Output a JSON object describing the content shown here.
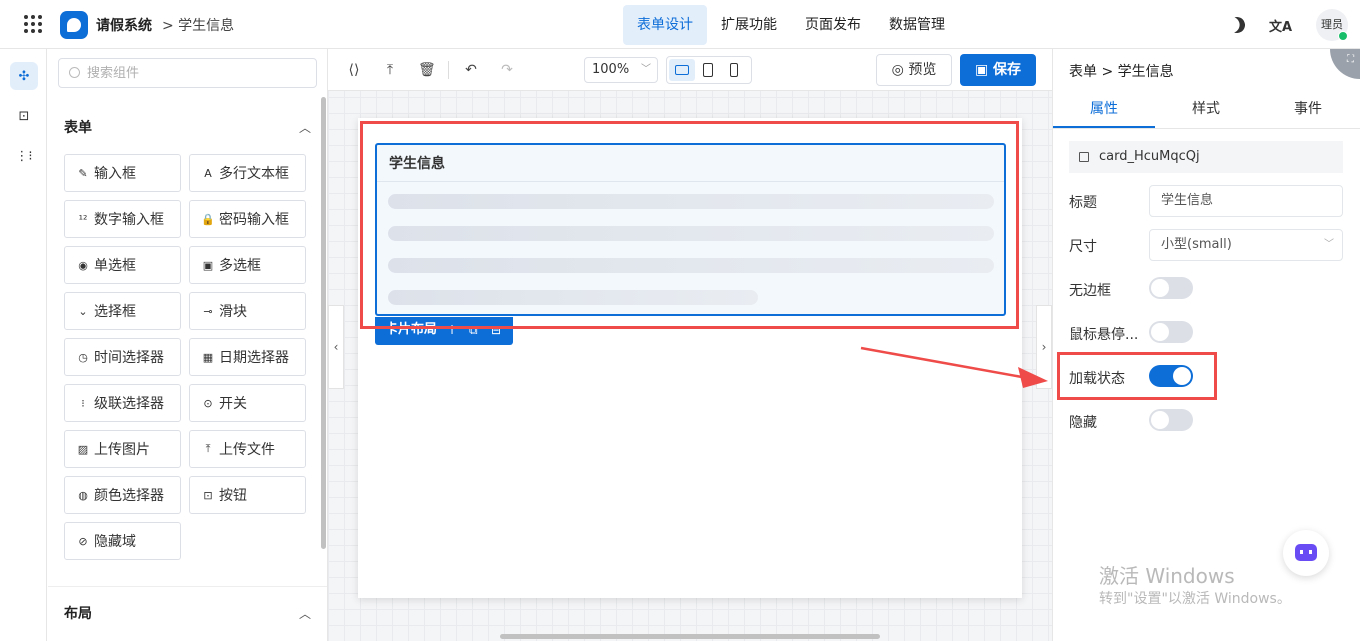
{
  "header": {
    "app_name": "请假系统",
    "breadcrumb": "> 学生信息",
    "nav": [
      "表单设计",
      "扩展功能",
      "页面发布",
      "数据管理"
    ],
    "active_nav": "表单设计",
    "lang_label": "文A",
    "avatar_label": "理员"
  },
  "component_panel": {
    "search_placeholder": "搜索组件",
    "group_form": "表单",
    "group_layout": "布局",
    "items": [
      {
        "label": "输入框",
        "icon": "edit-icon"
      },
      {
        "label": "多行文本框",
        "icon": "textarea-icon"
      },
      {
        "label": "数字输入框",
        "icon": "number-icon"
      },
      {
        "label": "密码输入框",
        "icon": "lock-icon"
      },
      {
        "label": "单选框",
        "icon": "radio-icon"
      },
      {
        "label": "多选框",
        "icon": "checkbox-icon"
      },
      {
        "label": "选择框",
        "icon": "select-icon"
      },
      {
        "label": "滑块",
        "icon": "slider-icon"
      },
      {
        "label": "时间选择器",
        "icon": "clock-icon"
      },
      {
        "label": "日期选择器",
        "icon": "calendar-icon"
      },
      {
        "label": "级联选择器",
        "icon": "cascader-icon"
      },
      {
        "label": "开关",
        "icon": "switch-icon"
      },
      {
        "label": "上传图片",
        "icon": "image-icon"
      },
      {
        "label": "上传文件",
        "icon": "upload-icon"
      },
      {
        "label": "颜色选择器",
        "icon": "palette-icon"
      },
      {
        "label": "按钮",
        "icon": "button-icon"
      },
      {
        "label": "隐藏域",
        "icon": "eye-off-icon"
      }
    ]
  },
  "toolbar": {
    "zoom": "100%",
    "preview_label": "预览",
    "save_label": "保存"
  },
  "canvas": {
    "card_title": "学生信息",
    "card_tag": "卡片布局"
  },
  "props": {
    "breadcrumb": "表单 > 学生信息",
    "tabs": [
      "属性",
      "样式",
      "事件"
    ],
    "active_tab": "属性",
    "component_id": "card_HcuMqcQj",
    "title_label": "标题",
    "title_value": "学生信息",
    "size_label": "尺寸",
    "size_value": "小型(small)",
    "no_border_label": "无边框",
    "no_border": false,
    "hover_label": "鼠标悬停...",
    "hover": false,
    "loading_label": "加载状态",
    "loading": true,
    "hidden_label": "隐藏",
    "hidden": false
  },
  "watermark": {
    "line1": "激活 Windows",
    "line2": "转到\"设置\"以激活 Windows。"
  },
  "colors": {
    "accent": "#0e6ed8",
    "highlight": "#ee4b49"
  }
}
